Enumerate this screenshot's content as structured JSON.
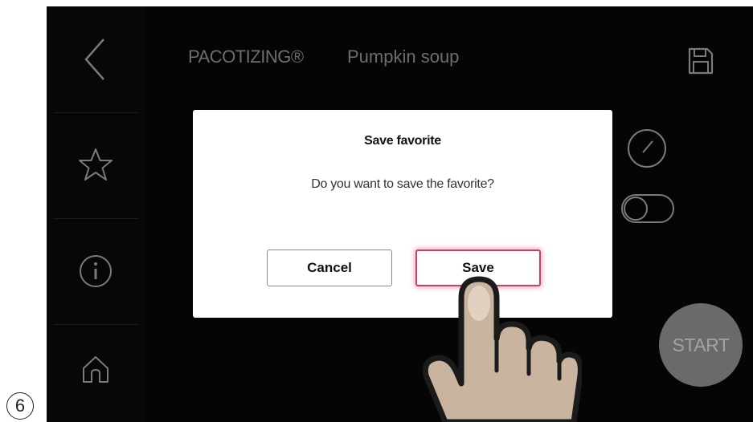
{
  "header": {
    "brand": "PACOTIZING®",
    "recipe": "Pumpkin soup"
  },
  "sidebar": {
    "items": [
      {
        "icon": "back-arrow-icon"
      },
      {
        "icon": "star-icon"
      },
      {
        "icon": "info-icon"
      },
      {
        "icon": "home-icon"
      }
    ]
  },
  "controls": {
    "start_label": "START"
  },
  "dialog": {
    "title": "Save favorite",
    "message": "Do you want to save the favorite?",
    "cancel_label": "Cancel",
    "save_label": "Save"
  },
  "step": {
    "number": "6"
  },
  "colors": {
    "screen_bg": "#050505",
    "icon_stroke": "#7a7a7a",
    "start_button": "#6a6a6a",
    "save_highlight": "#c8406a"
  }
}
